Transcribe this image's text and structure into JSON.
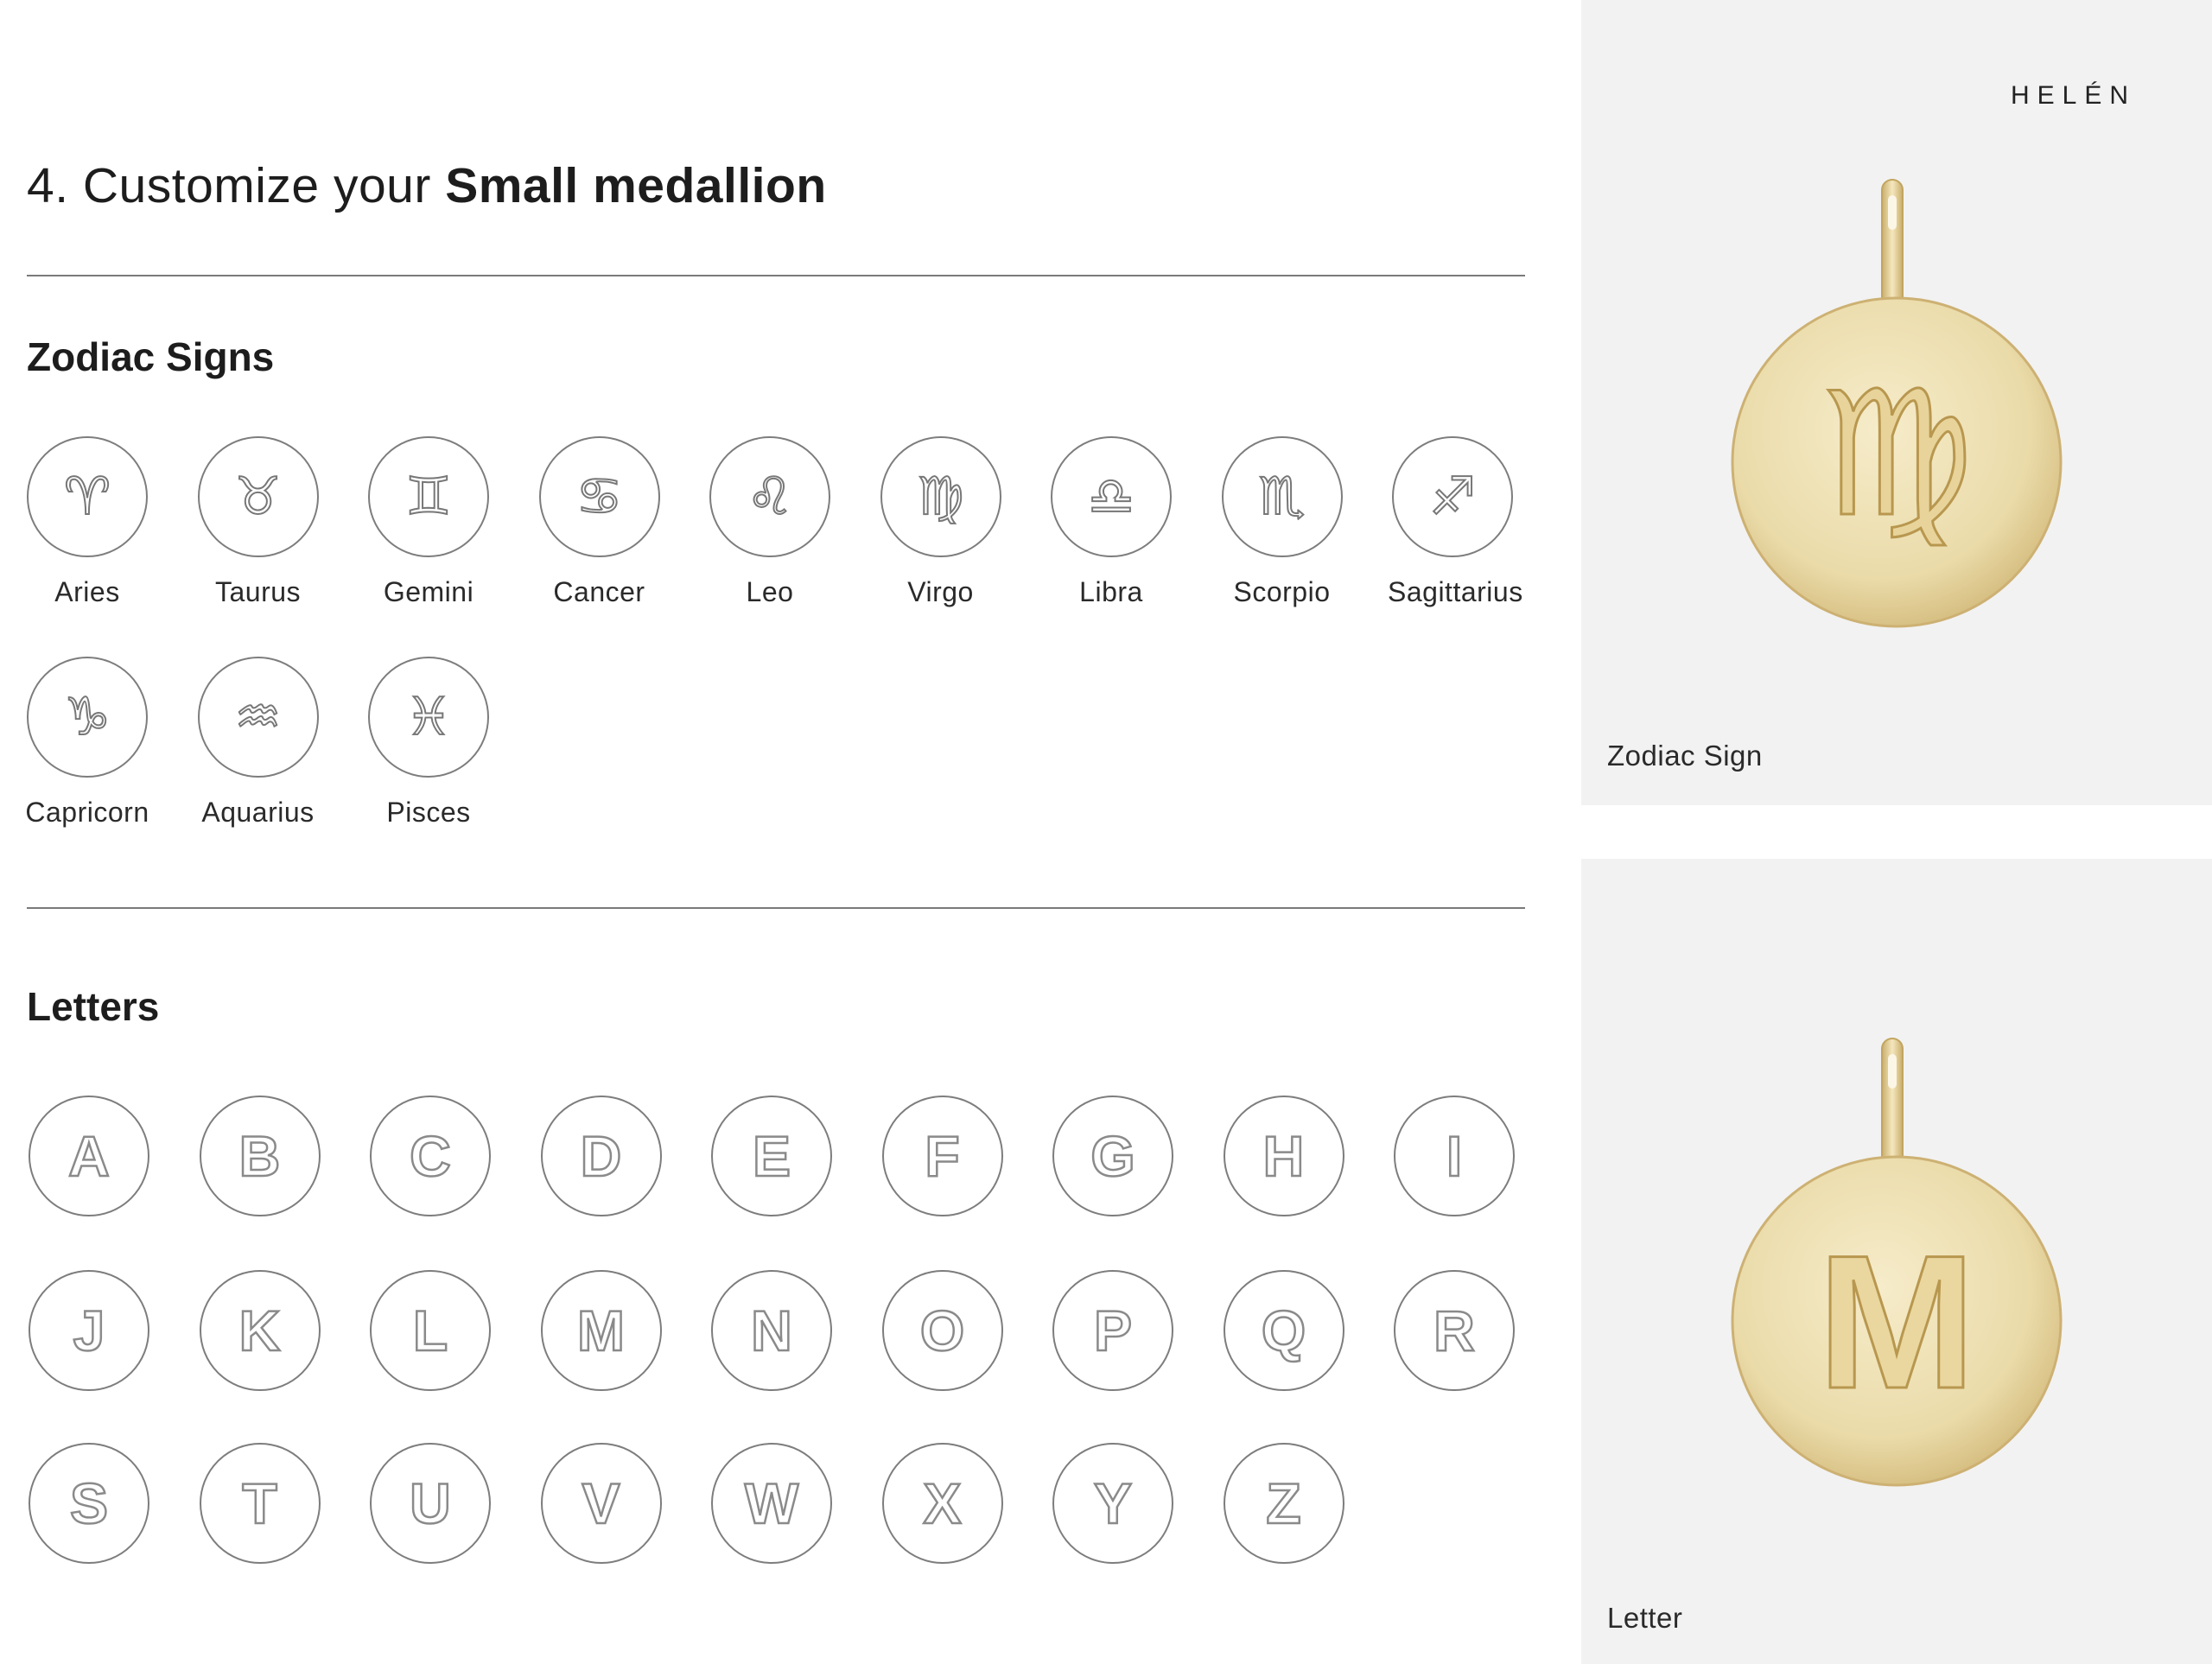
{
  "header": {
    "title_prefix": "4. Customize your",
    "title_product": "Small medallion"
  },
  "zodiac": {
    "heading": "Zodiac Signs",
    "items": [
      {
        "label": "Aries",
        "icon": "aries-icon",
        "glyph": "♈"
      },
      {
        "label": "Taurus",
        "icon": "taurus-icon",
        "glyph": "♉"
      },
      {
        "label": "Gemini",
        "icon": "gemini-icon",
        "glyph": "♊"
      },
      {
        "label": "Cancer",
        "icon": "cancer-icon",
        "glyph": "♋"
      },
      {
        "label": "Leo",
        "icon": "leo-icon",
        "glyph": "♌"
      },
      {
        "label": "Virgo",
        "icon": "virgo-icon",
        "glyph": "♍"
      },
      {
        "label": "Libra",
        "icon": "libra-icon",
        "glyph": "♎"
      },
      {
        "label": "Scorpio",
        "icon": "scorpio-icon",
        "glyph": "♏"
      },
      {
        "label": "Sagittarius",
        "icon": "sagittarius-icon",
        "glyph": "♐"
      },
      {
        "label": "Capricorn",
        "icon": "capricorn-icon",
        "glyph": "♑"
      },
      {
        "label": "Aquarius",
        "icon": "aquarius-icon",
        "glyph": "♒"
      },
      {
        "label": "Pisces",
        "icon": "pisces-icon",
        "glyph": "♓"
      }
    ]
  },
  "letters": {
    "heading": "Letters",
    "items": [
      "A",
      "B",
      "C",
      "D",
      "E",
      "F",
      "G",
      "H",
      "I",
      "J",
      "K",
      "L",
      "M",
      "N",
      "O",
      "P",
      "Q",
      "R",
      "S",
      "T",
      "U",
      "V",
      "W",
      "X",
      "Y",
      "Z"
    ]
  },
  "preview": {
    "brand": "HELÉN",
    "zodiac_caption": "Zodiac Sign",
    "zodiac_engraving": "♍",
    "letter_caption": "Letter",
    "letter_engraving": "M"
  },
  "colors": {
    "gold_light": "#f3e6bf",
    "gold_mid": "#e4cf98",
    "gold_dark": "#c9ad6c",
    "panel_bg": "#f2f2f2",
    "outline": "#7d7d7d"
  }
}
